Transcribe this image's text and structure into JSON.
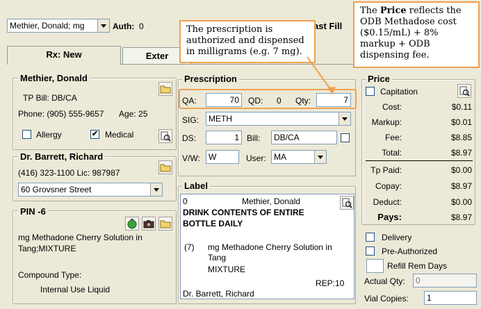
{
  "top": {
    "patient_select": "Methier, Donald; mg",
    "auth_label": "Auth:",
    "auth_value": "0",
    "last_fill_label": "ast Fill"
  },
  "tabs": {
    "rx_new": "Rx: New",
    "external": "Exter"
  },
  "patient": {
    "name": "Methier, Donald",
    "tp_bill": "TP Bill: DB/CA",
    "phone": "Phone: (905) 555-9657",
    "age": "Age: 25",
    "allergy_label": "Allergy",
    "allergy_checked": "",
    "medical_label": "Medical",
    "medical_checked": "✔"
  },
  "doctor": {
    "name": "Dr. Barrett, Richard",
    "phone_lic": "(416) 323-1100  Lic: 987987",
    "address": "60 Grovsner Street"
  },
  "pin": {
    "title": "PIN -6",
    "drug": "mg Methadone Cherry Solution in Tang;MIXTURE",
    "compound_type_label": "Compound Type:",
    "compound_type_value": "Internal Use Liquid"
  },
  "prescription": {
    "title": "Prescription",
    "qa_label": "QA:",
    "qa_value": "70",
    "qd_label": "QD:",
    "qd_value": "0",
    "qty_label": "Qty:",
    "qty_value": "7",
    "sig_label": "SIG:",
    "sig_value": "METH",
    "ds_label": "DS:",
    "ds_value": "1",
    "bill_label": "Bill:",
    "bill_value": "DB/CA",
    "vw_label": "V/W:",
    "vw_value": "W",
    "user_label": "User:",
    "user_value": "MA"
  },
  "label": {
    "title": "Label",
    "line1_left": "0",
    "line1_right": "Methier, Donald",
    "directions": "DRINK CONTENTS OF ENTIRE BOTTLE DAILY",
    "qty": "(7)",
    "drug_line1": "mg Methadone Cherry Solution in",
    "drug_line2": "Tang",
    "drug_line3": "MIXTURE",
    "rep": "REP:10",
    "doctor": "Dr. Barrett, Richard"
  },
  "price": {
    "title": "Price",
    "capitation_label": "Capitation",
    "rows": [
      {
        "label": "Cost:",
        "value": "$0.11"
      },
      {
        "label": "Markup:",
        "value": "$0.01"
      },
      {
        "label": "Fee:",
        "value": "$8.85"
      },
      {
        "label": "Total:",
        "value": "$8.97"
      },
      {
        "label": "Tp Paid:",
        "value": "$0.00"
      },
      {
        "label": "Copay:",
        "value": "$8.97"
      },
      {
        "label": "Deduct:",
        "value": "$0.00"
      },
      {
        "label": "Pays:",
        "value": "$8.97"
      }
    ],
    "delivery_label": "Delivery",
    "preauth_label": "Pre-Authorized",
    "refill_label": "Refill Rem Days",
    "actual_qty_label": "Actual Qty:",
    "actual_qty_value": "0",
    "vial_copies_label": "Vial Copies:",
    "vial_copies_value": "1"
  },
  "callouts": {
    "prescription_note": "The prescription is authorized and dispensed in milligrams (e.g. 7 mg).",
    "price_note_bold": "Price",
    "price_note_pre": "The ",
    "price_note_post": " reflects the ODB Methadose cost ($0.15/mL) + 8% markup + ODB dispensing fee."
  },
  "colors": {
    "accent": "#f0a050",
    "panel": "#ece9d8",
    "border": "#7f9db9"
  }
}
